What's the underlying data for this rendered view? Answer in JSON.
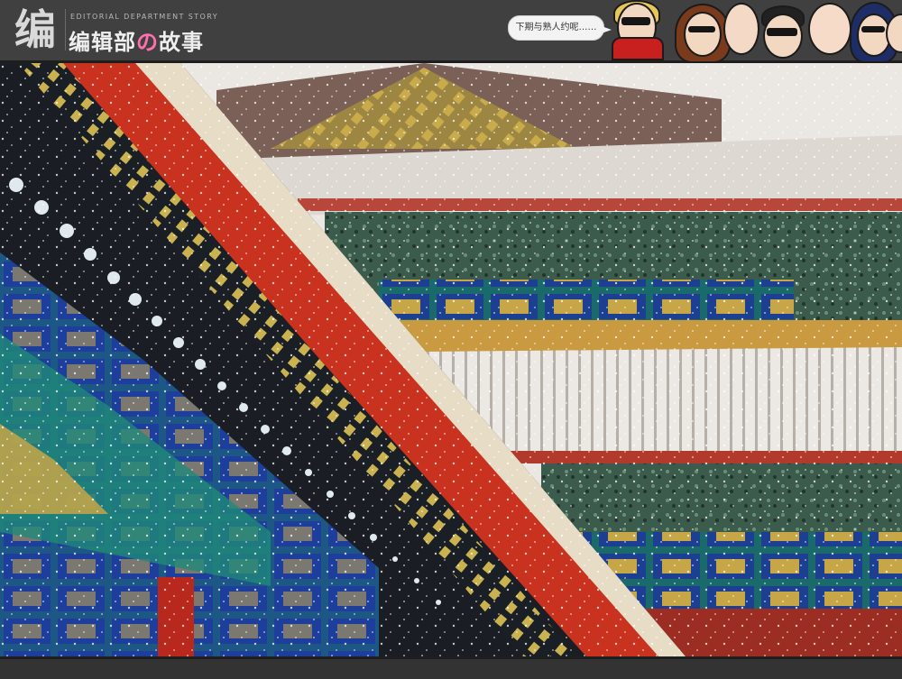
{
  "header": {
    "logo_mark": "编",
    "subtitle": "EDITORIAL DEPARTMENT STORY",
    "title_part1": "编辑部",
    "title_no": "の",
    "title_part2": "故事",
    "speech_bubble": "下期与熟人约呢……"
  },
  "colors": {
    "header_bg": "#404040",
    "accent_pink": "#ff6fae",
    "roof_red": "#c8321f",
    "painted_blue": "#1f3fa6",
    "painted_green": "#1f8a78",
    "gold": "#d4b25a"
  },
  "photo": {
    "subject": "snow-photo"
  }
}
